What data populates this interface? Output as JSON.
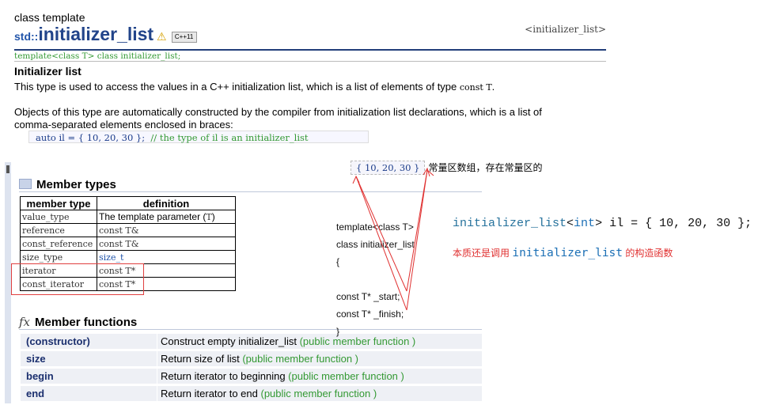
{
  "header": {
    "kind": "class template",
    "title_prefix": "std::",
    "title_main": "initializer_list",
    "badge": "C++11",
    "tag": "<initializer_list>"
  },
  "syntax": "template<class T> class initializer_list;",
  "section_title": "Initializer list",
  "desc1_text": "This type is used to access the values in a C++ initialization list, which is a list of elements of type ",
  "desc1_code": "const T",
  "desc2": "Objects of this type are automatically constructed by the compiler from initialization list declarations, which is a list of",
  "desc3": "comma-separated elements enclosed in braces:",
  "example": {
    "code": "auto il = { 10, 20, 30 };",
    "comment": "// the type of il is an initializer_list"
  },
  "array_note": {
    "code": "{ 10, 20, 30 }",
    "text": "常量区数组，存在常量区的"
  },
  "member_types": {
    "title": "Member types",
    "headers": [
      "member type",
      "definition"
    ],
    "rows": [
      {
        "type": "value_type",
        "def": "The template parameter (",
        "def_code": "T",
        "def_end": ")"
      },
      {
        "type": "reference",
        "def_code": "const T&"
      },
      {
        "type": "const_reference",
        "def_code": "const T&"
      },
      {
        "type": "size_type",
        "def_code": "size_t"
      },
      {
        "type": "iterator",
        "def_code": "const T*"
      },
      {
        "type": "const_iterator",
        "def_code": "const T*"
      }
    ]
  },
  "member_functions": {
    "title": "Member functions",
    "rows": [
      {
        "name": "(constructor)",
        "desc": "Construct empty initializer_list",
        "kind": "(public member function )"
      },
      {
        "name": "size",
        "desc": "Return size of list",
        "kind": "(public member function )"
      },
      {
        "name": "begin",
        "desc": "Return iterator to beginning",
        "kind": "(public member function )"
      },
      {
        "name": "end",
        "desc": "Return iterator to end",
        "kind": "(public member function )"
      }
    ]
  },
  "annotation_code": [
    "template<class T>",
    "class initializer_list",
    "{",
    "",
    "const T* _start;",
    "const T* _finish;",
    "}"
  ],
  "il_decl": {
    "cls": "initializer_list",
    "lt": "<",
    "kw": "int",
    "rest": "> il = { 10, 20, 30 };"
  },
  "note_red": {
    "before": "本质还是调用 ",
    "cls": "initializer_list",
    "after": " 的构造函数"
  },
  "colors": {
    "title": "#22448a",
    "green": "#339933",
    "annotation_red": "#e03030",
    "code_blue": "#1b6fb5"
  }
}
